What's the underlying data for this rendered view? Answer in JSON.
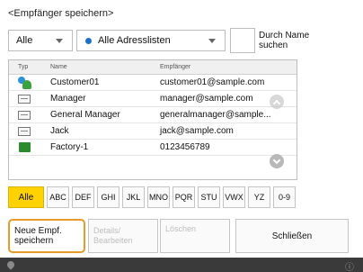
{
  "header": {
    "title": "<Empfänger speichern>"
  },
  "filters": {
    "type_select": "Alle",
    "list_select": "Alle Adresslisten",
    "name_search_label": "Durch Name suchen"
  },
  "table": {
    "columns": {
      "type": "Typ",
      "name": "Name",
      "recipient": "Empfänger"
    },
    "rows": [
      {
        "icon": "group-icon",
        "name": "Customer01",
        "recipient": "customer01@sample.com"
      },
      {
        "icon": "email-icon",
        "name": "Manager",
        "recipient": "manager@sample.com"
      },
      {
        "icon": "email-icon",
        "name": "General Manager",
        "recipient": "generalmanager@sample..."
      },
      {
        "icon": "email-icon",
        "name": "Jack",
        "recipient": "jack@sample.com"
      },
      {
        "icon": "fax-icon",
        "name": "Factory-1",
        "recipient": "0123456789"
      }
    ]
  },
  "index": [
    "Alle",
    "ABC",
    "DEF",
    "GHI",
    "JKL",
    "MNO",
    "PQR",
    "STU",
    "VWX",
    "YZ",
    "0-9"
  ],
  "buttons": {
    "new": "Neue Empf. speichern",
    "details": "Details/ Bearbeiten",
    "delete": "Löschen",
    "close": "Schließen"
  },
  "status": {
    "right_icon": "ⓘ"
  },
  "colors": {
    "accent": "#ffd200",
    "focus": "#e89a2a"
  }
}
